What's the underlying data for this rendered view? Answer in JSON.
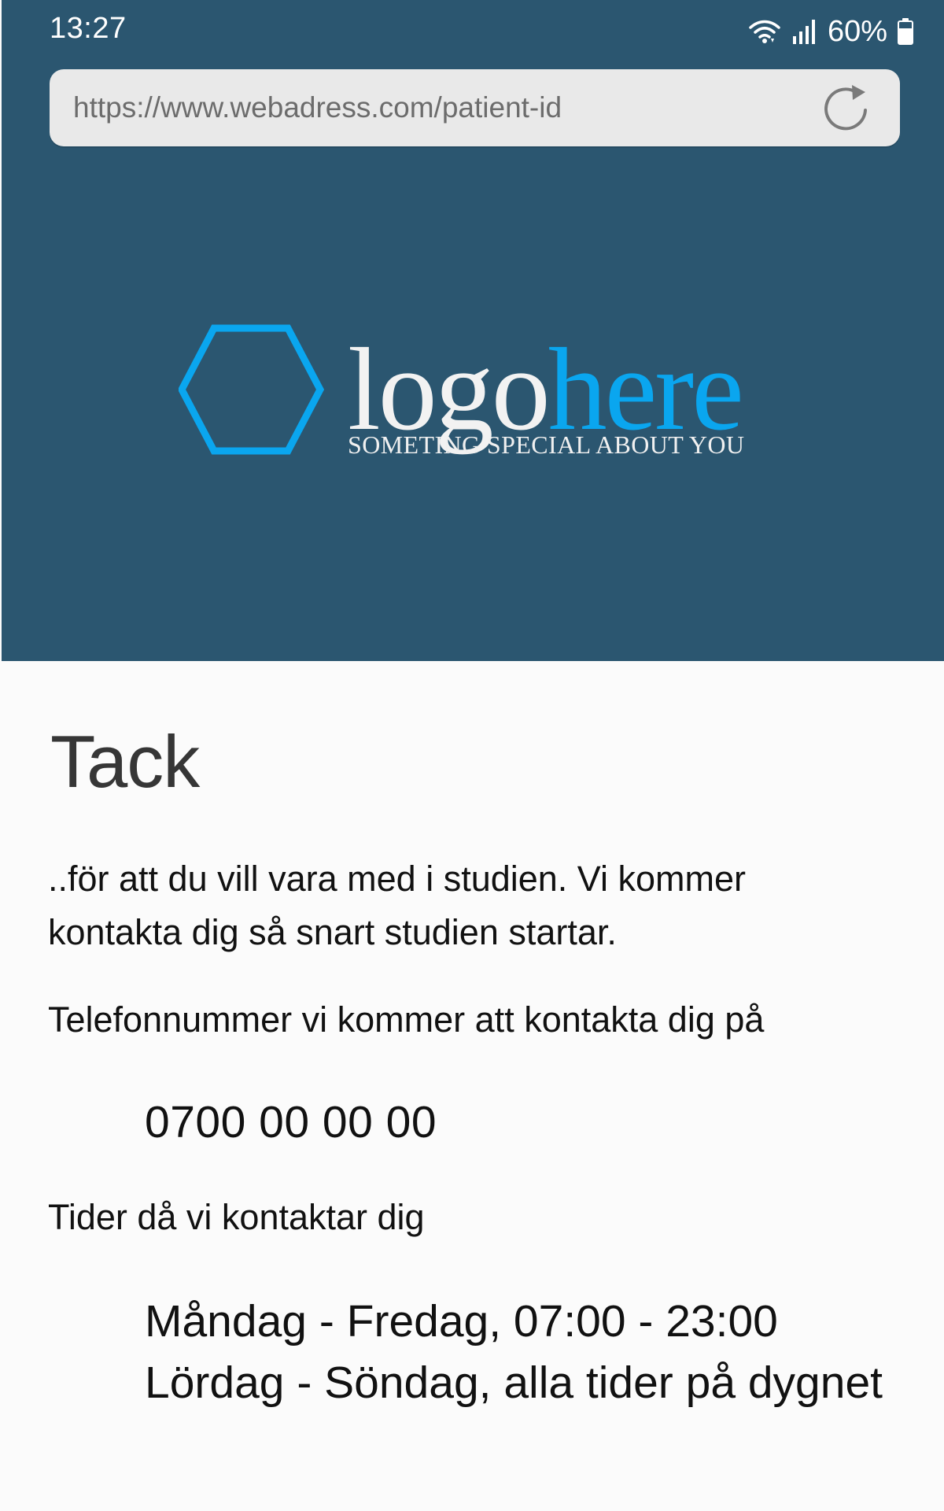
{
  "status_bar": {
    "time": "13:27",
    "battery_percent": "60%",
    "icons": [
      "wifi-icon",
      "signal-icon",
      "battery-icon"
    ]
  },
  "browser": {
    "url": "https://www.webadress.com/patient-id",
    "reload_icon": "reload-icon"
  },
  "logo": {
    "text_light": "logo",
    "text_accent": "here",
    "slogan": "SOMETING SPECIAL ABOUT YOU",
    "icon": "hexagon-icon"
  },
  "colors": {
    "header_background": "#2b5670",
    "accent": "#0aa6ef",
    "page_background": "#fbfbfb",
    "text": "#111111",
    "title_text": "#363636",
    "url_bar_background": "#e9e9e9"
  },
  "main": {
    "title": "Tack",
    "intro": "..för att du vill vara med i studien. Vi kommer kontakta dig så snart studien startar.",
    "phone_label": "Telefonnummer vi kommer att kontakta dig på",
    "phone_number": "0700 00 00 00",
    "times_label": "Tider då vi kontaktar dig",
    "times": [
      "Måndag - Fredag, 07:00 - 23:00",
      "Lördag - Söndag, alla tider på dygnet"
    ]
  }
}
